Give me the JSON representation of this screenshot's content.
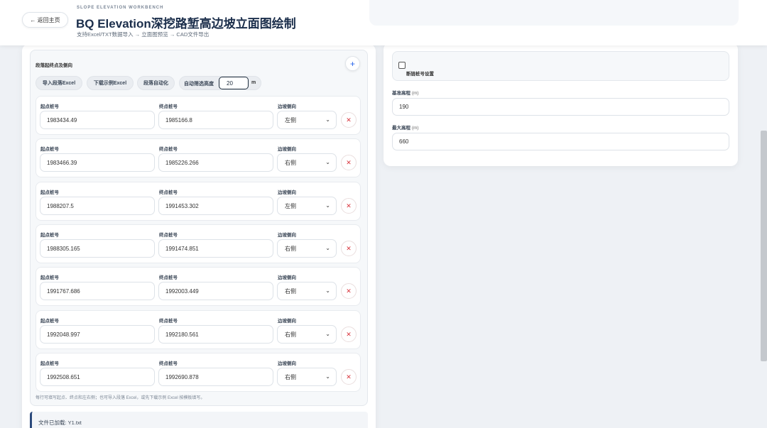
{
  "header": {
    "back_label": "← 返回主页",
    "kicker": "SLOPE ELEVATION WORKBENCH",
    "title": "BQ Elevation深挖路堑高边坡立面图绘制",
    "subtitle": "支持Excel/TXT数据导入 → 立面图预览 → CAD文件导出"
  },
  "segments": {
    "heading": "段落起终点及侧向",
    "add_label": "+",
    "import_label": "导入段落Excel",
    "download_label": "下载示例Excel",
    "auto_label": "段落自动化",
    "filter_label": "自动筛选高度",
    "filter_value": "20",
    "filter_unit": "m",
    "col_start": "起点桩号",
    "col_end": "终点桩号",
    "col_side": "边坡侧向",
    "rows": [
      {
        "start": "1983434.49",
        "end": "1985166.8",
        "side": "左侧"
      },
      {
        "start": "1983466.39",
        "end": "1985226.266",
        "side": "右侧"
      },
      {
        "start": "1988207.5",
        "end": "1991453.302",
        "side": "左侧"
      },
      {
        "start": "1988305.165",
        "end": "1991474.851",
        "side": "右侧"
      },
      {
        "start": "1991767.686",
        "end": "1992003.449",
        "side": "右侧"
      },
      {
        "start": "1992048.997",
        "end": "1992180.561",
        "side": "右侧"
      },
      {
        "start": "1992508.651",
        "end": "1992690.878",
        "side": "右侧"
      }
    ],
    "hint": "每行可填写起点、终点和左右侧；也可导入段落 Excel，或先下载示例 Excel 按模板填写。"
  },
  "status": {
    "line1": "文件已加载: Y1.txt"
  },
  "settings": {
    "broken_chain_label": "断链桩号设置",
    "base_elev_label": "基准高程",
    "base_elev_unit": "(m)",
    "base_elev_value": "190",
    "max_elev_label": "最大高程",
    "max_elev_unit": "(m)",
    "max_elev_value": "660"
  }
}
